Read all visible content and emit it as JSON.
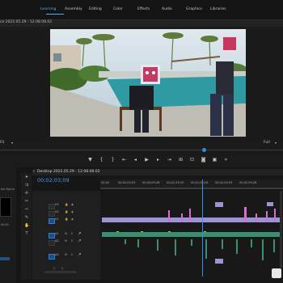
{
  "workspace_tabs": [
    "Learning",
    "Assembly",
    "Editing",
    "Color",
    "Effects",
    "Audio",
    "Graphics",
    "Libraries"
  ],
  "active_tab": "Learning",
  "program_monitor": {
    "title": "ce 2022.05.29 - 12.08.08.02",
    "fit_left": "Fit",
    "fit_right": "Full"
  },
  "transport": [
    "marker-icon",
    "mark-in-icon",
    "mark-out-icon",
    "go-to-in-icon",
    "step-back-icon",
    "play-icon",
    "step-forward-icon",
    "go-to-out-icon",
    "insert-icon",
    "overwrite-icon",
    "export-frame-icon",
    "compare-icon",
    "more-icon"
  ],
  "source_panel": {
    "label": "ble Name",
    "timecode": "00;01"
  },
  "timeline": {
    "sequence_name": "Desktop 2022.05.29 - 12.08.08.02",
    "timecode": "00;02;03;09",
    "ruler_ticks": [
      "00;00",
      "00;00;29;29",
      "00;00;59;28",
      "00;01;29;29",
      "00;01;59;28",
      "00;02;29;29",
      "00;02;59;28"
    ],
    "video_tracks": [
      "V3",
      "V2",
      "V1"
    ],
    "audio_tracks": [
      "A1",
      "A2",
      "A3"
    ],
    "sublabels": [
      "C",
      "C"
    ]
  },
  "colors": {
    "accent": "#2f8fff",
    "video_clip": "#9a93d6",
    "pink_clip": "#d26fd0",
    "audio_clip": "#3b8f6e",
    "marker": "#d9c02a"
  }
}
